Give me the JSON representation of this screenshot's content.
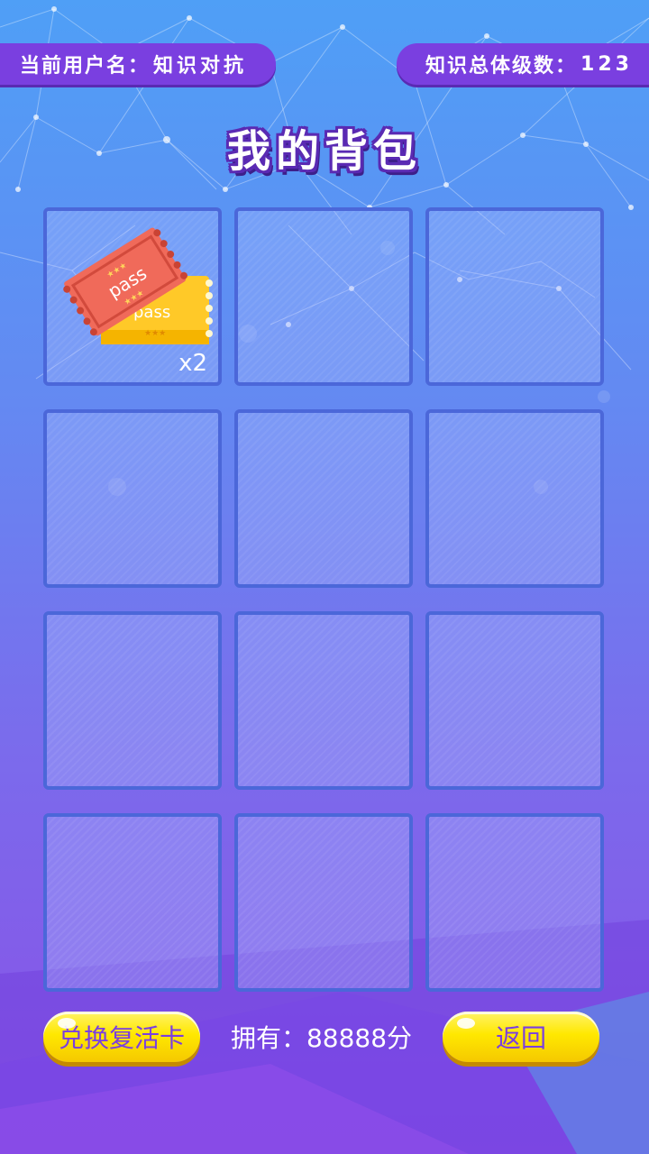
{
  "header": {
    "user_label": "当前用户名：",
    "user_name": "知识对抗",
    "level_label": "知识总体级数：",
    "level_value": "123"
  },
  "title": "我的背包",
  "inventory": {
    "slots": [
      {
        "item": "pass-tickets-icon",
        "ticket_red_text": "pass",
        "ticket_yellow_text": "pass",
        "count": "x2",
        "ticket_colors": {
          "red": "#f06a5a",
          "yellow": "#ffc928"
        }
      },
      {
        "item": null
      },
      {
        "item": null
      },
      {
        "item": null
      },
      {
        "item": null
      },
      {
        "item": null
      },
      {
        "item": null
      },
      {
        "item": null
      },
      {
        "item": null
      },
      {
        "item": null
      },
      {
        "item": null
      },
      {
        "item": null
      }
    ]
  },
  "footer": {
    "exchange_button": "兑换复活卡",
    "owned_text": "拥有：88888分",
    "back_button": "返回"
  },
  "colors": {
    "accent_purple": "#7a3fe0",
    "button_yellow": "#ffe800",
    "slot_border": "#4b67d9"
  }
}
